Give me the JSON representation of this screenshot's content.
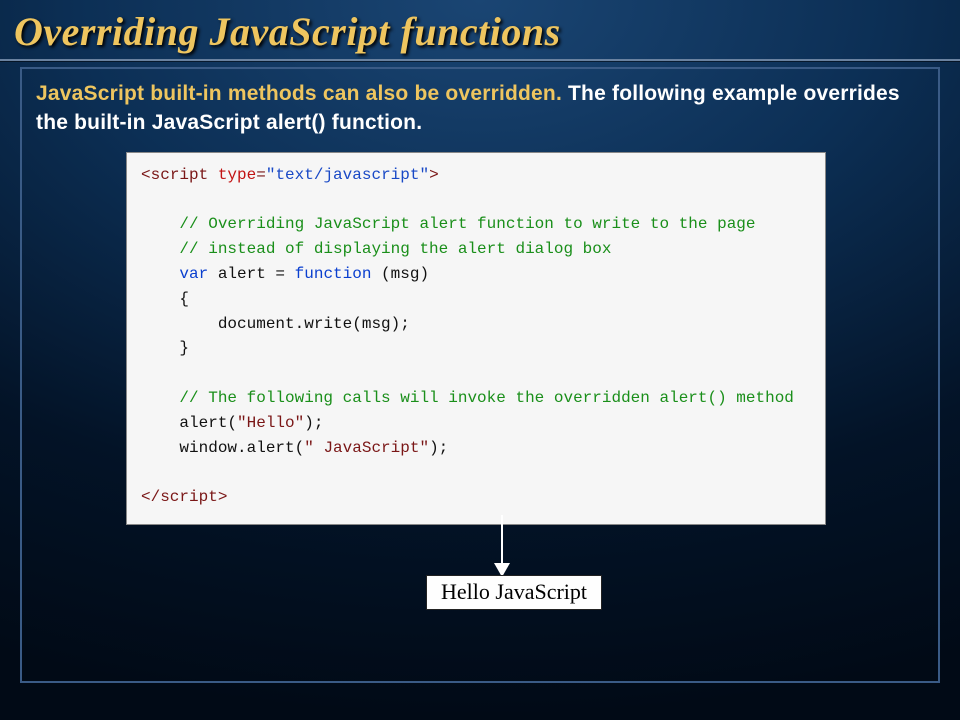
{
  "title": "Overriding JavaScript functions",
  "intro": {
    "highlight": "JavaScript built-in methods can also be overridden.",
    "rest": " The following example overrides the built-in JavaScript alert() function."
  },
  "code": {
    "l1_open": "<",
    "l1_tag": "script",
    "l1_sp": " ",
    "l1_attr": "type",
    "l1_eq": "=",
    "l1_val": "\"text/javascript\"",
    "l1_close": ">",
    "c1": "// Overriding JavaScript alert function to write to the page",
    "c2": "// instead of displaying the alert dialog box",
    "kw_var": "var",
    "id_alert": " alert = ",
    "kw_func": "function",
    "func_sig": " (msg)",
    "brace_open": "{",
    "body_line": "    document.write(msg);",
    "brace_close": "}",
    "c3": "// The following calls will invoke the overridden alert() method",
    "call1a": "alert(",
    "call1b": "\"Hello\"",
    "call1c": ");",
    "call2a": "window.alert(",
    "call2b": "\" JavaScript\"",
    "call2c": ");",
    "end_open": "</",
    "end_tag": "script",
    "end_close": ">"
  },
  "output": "Hello JavaScript"
}
